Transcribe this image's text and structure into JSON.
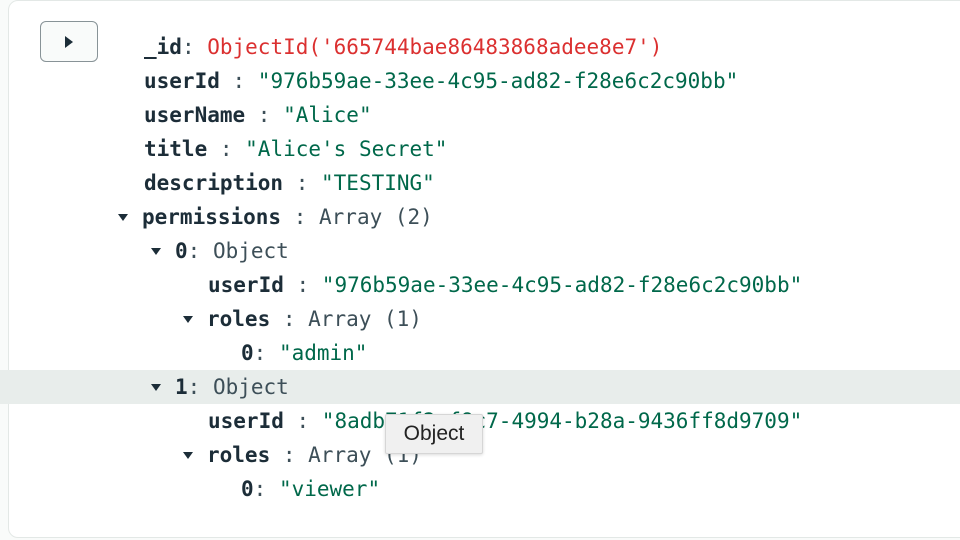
{
  "document": {
    "id": {
      "key": "_id",
      "sep": ": ",
      "value": "ObjectId('665744bae86483868adee8e7')"
    },
    "userId": {
      "key": "userId",
      "sep": " : ",
      "value": "\"976b59ae-33ee-4c95-ad82-f28e6c2c90bb\""
    },
    "userName": {
      "key": "userName",
      "sep": " : ",
      "value": "\"Alice\""
    },
    "title": {
      "key": "title",
      "sep": " : ",
      "value": "\"Alice's Secret\""
    },
    "description": {
      "key": "description",
      "sep": " : ",
      "value": "\"TESTING\""
    },
    "permissions": {
      "key": "permissions",
      "sep": " : ",
      "type": "Array (2)",
      "items": [
        {
          "index": "0",
          "sep": ": ",
          "type": "Object",
          "userId": {
            "key": "userId",
            "sep": " : ",
            "value": "\"976b59ae-33ee-4c95-ad82-f28e6c2c90bb\""
          },
          "roles": {
            "key": "roles",
            "sep": " : ",
            "type": "Array (1)",
            "items": [
              {
                "index": "0",
                "sep": ": ",
                "value": "\"admin\""
              }
            ]
          }
        },
        {
          "index": "1",
          "sep": ": ",
          "type": "Object",
          "userId": {
            "key": "userId",
            "sep": " : ",
            "value": "\"8adb71f2-f8c7-4994-b28a-9436ff8d9709\""
          },
          "roles": {
            "key": "roles",
            "sep": " : ",
            "type": "Array (1)",
            "items": [
              {
                "index": "0",
                "sep": ": ",
                "value": "\"viewer\""
              }
            ]
          }
        }
      ]
    }
  },
  "tooltip": {
    "text": "Object"
  },
  "icons": {
    "expand": "play-triangle-icon",
    "caret": "caret-down-icon"
  },
  "colors": {
    "key": "#1c2d38",
    "string": "#00684a",
    "objectid": "#db3030",
    "highlight": "#e8edeb"
  }
}
